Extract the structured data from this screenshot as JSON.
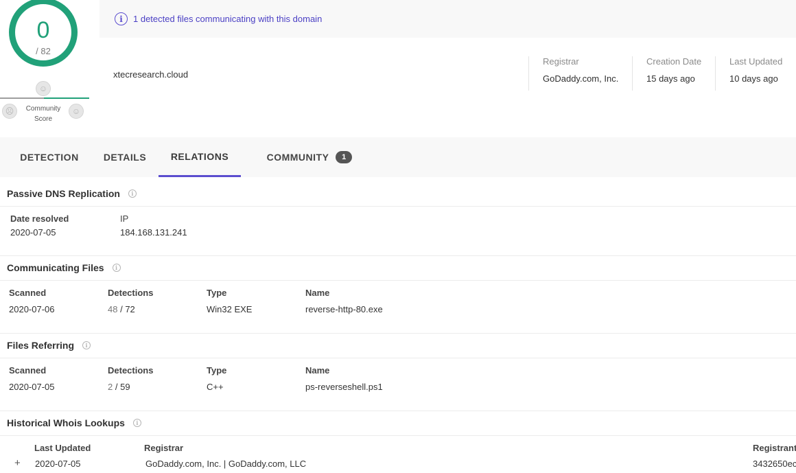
{
  "score": {
    "detections": "0",
    "total": "/ 82",
    "community_label": "Community\nScore"
  },
  "banner": {
    "icon": "info-icon",
    "text": "1 detected files communicating with this domain"
  },
  "domain": "xtecresearch.cloud",
  "meta": [
    {
      "label": "Registrar",
      "value": "GoDaddy.com, Inc."
    },
    {
      "label": "Creation Date",
      "value": "15 days ago"
    },
    {
      "label": "Last Updated",
      "value": "10 days ago"
    }
  ],
  "tabs": [
    {
      "label": "DETECTION"
    },
    {
      "label": "DETAILS"
    },
    {
      "label": "RELATIONS",
      "active": true
    },
    {
      "label": "COMMUNITY",
      "badge": "1"
    }
  ],
  "passive_dns": {
    "title": "Passive DNS Replication",
    "columns": [
      "Date resolved",
      "IP"
    ],
    "rows": [
      [
        "2020-07-05",
        "184.168.131.241"
      ]
    ]
  },
  "communicating_files": {
    "title": "Communicating Files",
    "columns": [
      "Scanned",
      "Detections",
      "Type",
      "Name"
    ],
    "rows": [
      {
        "scanned": "2020-07-06",
        "det": "48",
        "det_total": "/ 72",
        "type": "Win32 EXE",
        "name": "reverse-http-80.exe"
      }
    ]
  },
  "files_referring": {
    "title": "Files Referring",
    "columns": [
      "Scanned",
      "Detections",
      "Type",
      "Name"
    ],
    "rows": [
      {
        "scanned": "2020-07-05",
        "det": "2",
        "det_total": "/ 59",
        "type": "C++",
        "name": "ps-reverseshell.ps1"
      }
    ]
  },
  "whois": {
    "title": "Historical Whois Lookups",
    "columns": [
      "Last Updated",
      "Registrar",
      "Registrant"
    ],
    "rows": [
      {
        "expand": "+",
        "updated": "2020-07-05",
        "registrar": "GoDaddy.com, Inc. | GoDaddy.com, LLC",
        "registrant": "3432650ec"
      }
    ]
  },
  "colors": {
    "accent": "#5b4dcf",
    "score_green": "#21a179"
  }
}
